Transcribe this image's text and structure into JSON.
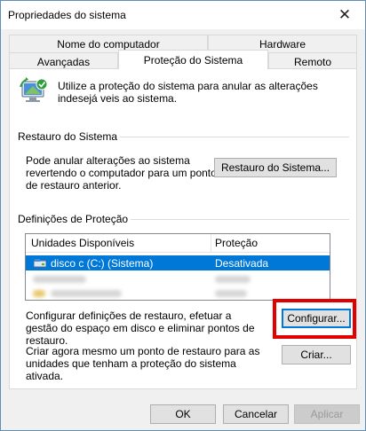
{
  "window": {
    "title": "Propriedades do sistema",
    "close_glyph": "✕"
  },
  "tabs": {
    "top_row": [
      {
        "label": "Nome do computador"
      },
      {
        "label": "Hardware"
      }
    ],
    "bottom_row": [
      {
        "label": "Avançadas"
      },
      {
        "label": "Proteção do Sistema",
        "active": true
      },
      {
        "label": "Remoto"
      }
    ]
  },
  "intro": {
    "icon": "system-protection-icon",
    "text": "Utilize a proteção do sistema para anular as alterações indesejá veis ao sistema."
  },
  "restore_group": {
    "label": "Restauro do Sistema",
    "description": "Pode anular alterações ao sistema revertendo o computador para um ponto de restauro anterior.",
    "button_label": "Restauro do Sistema..."
  },
  "protection_group": {
    "label": "Definições de Proteção",
    "columns": [
      "Unidades Disponíveis",
      "Proteção"
    ],
    "rows": [
      {
        "name": "disco c (C:) (Sistema)",
        "protection": "Desativada",
        "selected": true,
        "icon": "drive-icon"
      }
    ],
    "configure_text": "Configurar definições de restauro, efetuar a gestão do espaço em disco e eliminar pontos de restauro.",
    "configure_button": "Configurar...",
    "create_text": "Criar agora mesmo um ponto de restauro para as unidades que tenham a proteção do sistema ativada.",
    "create_button": "Criar..."
  },
  "footer": {
    "ok": "OK",
    "cancel": "Cancelar",
    "apply": "Aplicar"
  },
  "colors": {
    "selection": "#0078d7",
    "highlight_frame": "#e00000",
    "window_border": "#5f8fb7"
  }
}
